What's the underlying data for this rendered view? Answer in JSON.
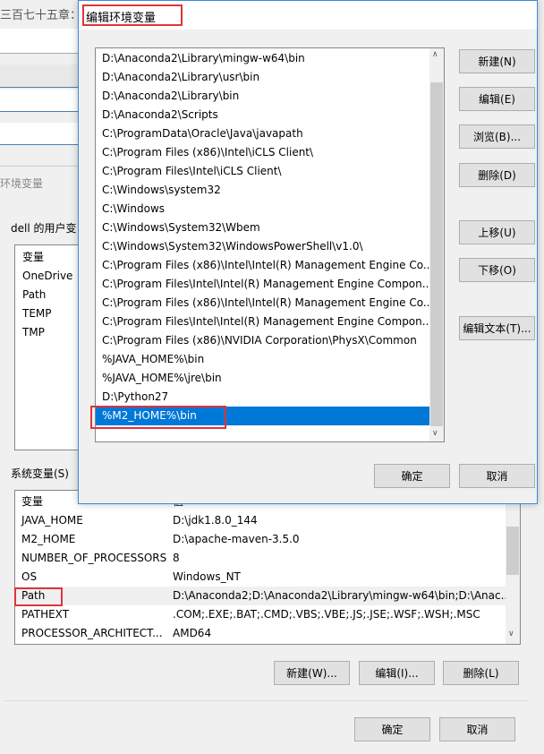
{
  "background_app": {
    "title": "三百七十五章："
  },
  "env_dialog": {
    "title": "环境变量",
    "user_group": "dell 的用户变",
    "user_header": "变量",
    "user_vars": [
      "OneDrive",
      "Path",
      "TEMP",
      "TMP"
    ],
    "system_group": "系统变量(S)",
    "system_header": [
      "变量",
      "值"
    ],
    "system_vars": [
      {
        "name": "JAVA_HOME",
        "value": "D:\\jdk1.8.0_144"
      },
      {
        "name": "M2_HOME",
        "value": "D:\\apache-maven-3.5.0"
      },
      {
        "name": "NUMBER_OF_PROCESSORS",
        "value": "8"
      },
      {
        "name": "OS",
        "value": "Windows_NT"
      },
      {
        "name": "Path",
        "value": "D:\\Anaconda2;D:\\Anaconda2\\Library\\mingw-w64\\bin;D:\\Anac..."
      },
      {
        "name": "PATHEXT",
        "value": ".COM;.EXE;.BAT;.CMD;.VBS;.VBE;.JS;.JSE;.WSF;.WSH;.MSC"
      },
      {
        "name": "PROCESSOR_ARCHITECT...",
        "value": "AMD64"
      }
    ],
    "buttons": {
      "new": "新建(W)...",
      "edit": "编辑(I)...",
      "delete": "删除(L)",
      "ok": "确定",
      "cancel": "取消"
    }
  },
  "edit_dialog": {
    "title": "编辑环境变量",
    "paths": [
      "D:\\Anaconda2\\Library\\mingw-w64\\bin",
      "D:\\Anaconda2\\Library\\usr\\bin",
      "D:\\Anaconda2\\Library\\bin",
      "D:\\Anaconda2\\Scripts",
      "C:\\ProgramData\\Oracle\\Java\\javapath",
      "C:\\Program Files (x86)\\Intel\\iCLS Client\\",
      "C:\\Program Files\\Intel\\iCLS Client\\",
      "C:\\Windows\\system32",
      "C:\\Windows",
      "C:\\Windows\\System32\\Wbem",
      "C:\\Windows\\System32\\WindowsPowerShell\\v1.0\\",
      "C:\\Program Files (x86)\\Intel\\Intel(R) Management Engine Co...",
      "C:\\Program Files\\Intel\\Intel(R) Management Engine Compon...",
      "C:\\Program Files (x86)\\Intel\\Intel(R) Management Engine Co...",
      "C:\\Program Files\\Intel\\Intel(R) Management Engine Compon...",
      "C:\\Program Files (x86)\\NVIDIA Corporation\\PhysX\\Common",
      "%JAVA_HOME%\\bin",
      "%JAVA_HOME%\\jre\\bin",
      "D:\\Python27",
      "%M2_HOME%\\bin"
    ],
    "selected_index": 19,
    "buttons": {
      "new": "新建(N)",
      "edit": "编辑(E)",
      "browse": "浏览(B)...",
      "delete": "删除(D)",
      "up": "上移(U)",
      "down": "下移(O)",
      "edit_text": "编辑文本(T)...",
      "ok": "确定",
      "cancel": "取消"
    }
  },
  "colors": {
    "selection": "#0078d7",
    "highlight_box": "#e0343a"
  }
}
